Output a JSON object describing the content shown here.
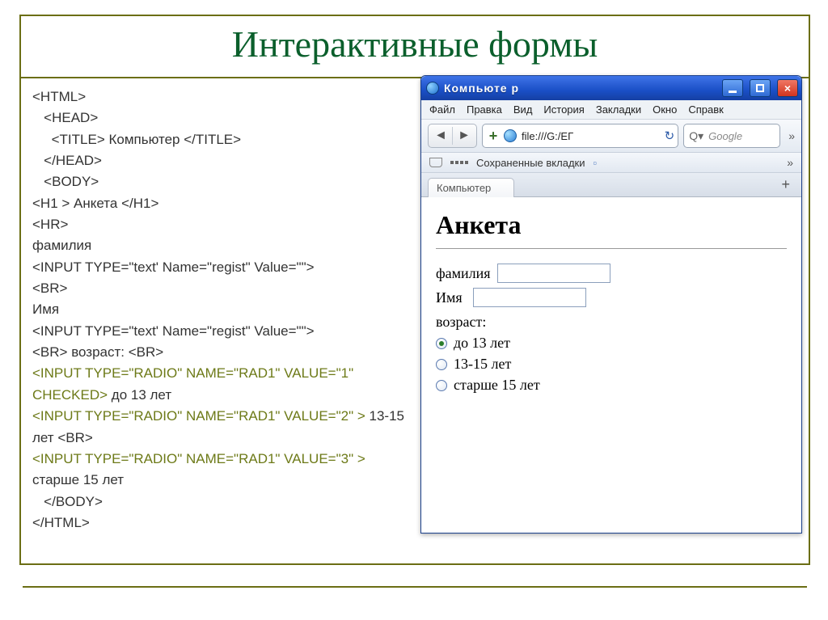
{
  "slide_title": "Интерактивные формы",
  "code": {
    "l1": "<HTML>",
    "l2": "<HEAD>",
    "l3a": "<TITLE>",
    "l3b": " Компьютер ",
    "l3c": "</TITLE>",
    "l4": "</HEAD>",
    "l5": "<BODY>",
    "l6a": "<H1 >",
    "l6b": " Анкета ",
    "l6c": "</H1>",
    "l7": "<HR>",
    "l8": "фамилия",
    "l9": "<INPUT TYPE=\"text' Name=\"regist\" Value=\"\">",
    "l10": "<BR>",
    "l11": "Имя",
    "l12": "<INPUT TYPE=\"text' Name=\"regist\" Value=\"\">",
    "l13a": "<BR>",
    "l13b": " возраст: ",
    "l13c": "<BR>",
    "r1a": "<INPUT TYPE=\"radio\" NAME=\"rad1\" VALUE=\"1\" Checked>",
    "r1b": " до 13 лет",
    "r2a": "<INPUT TYPE=\"radio\" NAME=\"rad1\" VALUE=\"2\" >",
    "r2b": " 13-15 лет ",
    "r2c": "<BR>",
    "r3a": "<INPUT TYPE=\"radio\" NAME=\"rad1\" VALUE=\"3\" >",
    "r3b": " старше 15 лет",
    "l14": "</BODY>",
    "l15": "</HTML>"
  },
  "browser": {
    "title": "Компьюте р",
    "menu": [
      "Файл",
      "Правка",
      "Вид",
      "История",
      "Закладки",
      "Окно",
      "Справк"
    ],
    "url": "file:///G:/ЕГ",
    "search_placeholder": "Google",
    "bookmarks_label": "Сохраненные вкладки",
    "tab_label": "Компьютер",
    "page": {
      "heading": "Анкета",
      "field1": "фамилия",
      "field2": "Имя",
      "age_label": "возраст:",
      "opts": [
        "до 13 лет",
        "13-15 лет",
        "старше 15 лет"
      ]
    }
  }
}
